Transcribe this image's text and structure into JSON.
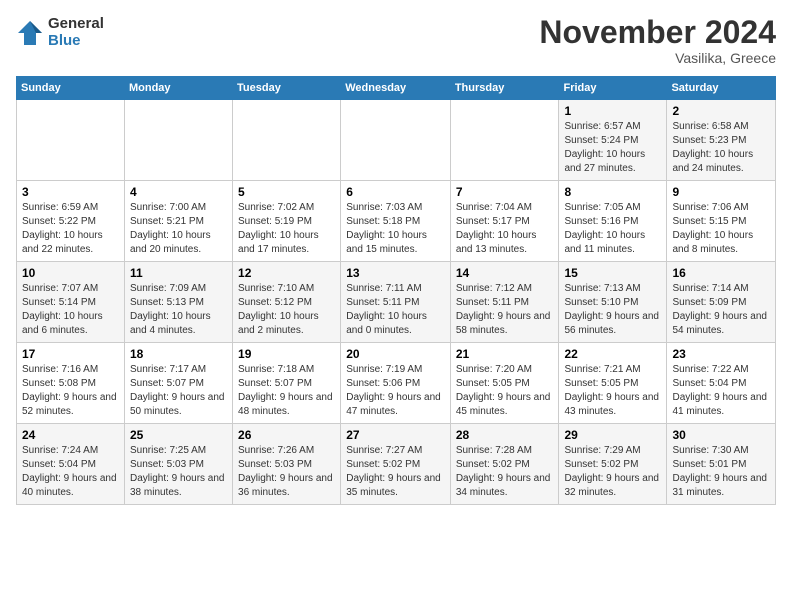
{
  "logo": {
    "general": "General",
    "blue": "Blue"
  },
  "title": "November 2024",
  "location": "Vasilika, Greece",
  "days_header": [
    "Sunday",
    "Monday",
    "Tuesday",
    "Wednesday",
    "Thursday",
    "Friday",
    "Saturday"
  ],
  "weeks": [
    [
      {
        "day": "",
        "info": ""
      },
      {
        "day": "",
        "info": ""
      },
      {
        "day": "",
        "info": ""
      },
      {
        "day": "",
        "info": ""
      },
      {
        "day": "",
        "info": ""
      },
      {
        "day": "1",
        "info": "Sunrise: 6:57 AM\nSunset: 5:24 PM\nDaylight: 10 hours and 27 minutes."
      },
      {
        "day": "2",
        "info": "Sunrise: 6:58 AM\nSunset: 5:23 PM\nDaylight: 10 hours and 24 minutes."
      }
    ],
    [
      {
        "day": "3",
        "info": "Sunrise: 6:59 AM\nSunset: 5:22 PM\nDaylight: 10 hours and 22 minutes."
      },
      {
        "day": "4",
        "info": "Sunrise: 7:00 AM\nSunset: 5:21 PM\nDaylight: 10 hours and 20 minutes."
      },
      {
        "day": "5",
        "info": "Sunrise: 7:02 AM\nSunset: 5:19 PM\nDaylight: 10 hours and 17 minutes."
      },
      {
        "day": "6",
        "info": "Sunrise: 7:03 AM\nSunset: 5:18 PM\nDaylight: 10 hours and 15 minutes."
      },
      {
        "day": "7",
        "info": "Sunrise: 7:04 AM\nSunset: 5:17 PM\nDaylight: 10 hours and 13 minutes."
      },
      {
        "day": "8",
        "info": "Sunrise: 7:05 AM\nSunset: 5:16 PM\nDaylight: 10 hours and 11 minutes."
      },
      {
        "day": "9",
        "info": "Sunrise: 7:06 AM\nSunset: 5:15 PM\nDaylight: 10 hours and 8 minutes."
      }
    ],
    [
      {
        "day": "10",
        "info": "Sunrise: 7:07 AM\nSunset: 5:14 PM\nDaylight: 10 hours and 6 minutes."
      },
      {
        "day": "11",
        "info": "Sunrise: 7:09 AM\nSunset: 5:13 PM\nDaylight: 10 hours and 4 minutes."
      },
      {
        "day": "12",
        "info": "Sunrise: 7:10 AM\nSunset: 5:12 PM\nDaylight: 10 hours and 2 minutes."
      },
      {
        "day": "13",
        "info": "Sunrise: 7:11 AM\nSunset: 5:11 PM\nDaylight: 10 hours and 0 minutes."
      },
      {
        "day": "14",
        "info": "Sunrise: 7:12 AM\nSunset: 5:11 PM\nDaylight: 9 hours and 58 minutes."
      },
      {
        "day": "15",
        "info": "Sunrise: 7:13 AM\nSunset: 5:10 PM\nDaylight: 9 hours and 56 minutes."
      },
      {
        "day": "16",
        "info": "Sunrise: 7:14 AM\nSunset: 5:09 PM\nDaylight: 9 hours and 54 minutes."
      }
    ],
    [
      {
        "day": "17",
        "info": "Sunrise: 7:16 AM\nSunset: 5:08 PM\nDaylight: 9 hours and 52 minutes."
      },
      {
        "day": "18",
        "info": "Sunrise: 7:17 AM\nSunset: 5:07 PM\nDaylight: 9 hours and 50 minutes."
      },
      {
        "day": "19",
        "info": "Sunrise: 7:18 AM\nSunset: 5:07 PM\nDaylight: 9 hours and 48 minutes."
      },
      {
        "day": "20",
        "info": "Sunrise: 7:19 AM\nSunset: 5:06 PM\nDaylight: 9 hours and 47 minutes."
      },
      {
        "day": "21",
        "info": "Sunrise: 7:20 AM\nSunset: 5:05 PM\nDaylight: 9 hours and 45 minutes."
      },
      {
        "day": "22",
        "info": "Sunrise: 7:21 AM\nSunset: 5:05 PM\nDaylight: 9 hours and 43 minutes."
      },
      {
        "day": "23",
        "info": "Sunrise: 7:22 AM\nSunset: 5:04 PM\nDaylight: 9 hours and 41 minutes."
      }
    ],
    [
      {
        "day": "24",
        "info": "Sunrise: 7:24 AM\nSunset: 5:04 PM\nDaylight: 9 hours and 40 minutes."
      },
      {
        "day": "25",
        "info": "Sunrise: 7:25 AM\nSunset: 5:03 PM\nDaylight: 9 hours and 38 minutes."
      },
      {
        "day": "26",
        "info": "Sunrise: 7:26 AM\nSunset: 5:03 PM\nDaylight: 9 hours and 36 minutes."
      },
      {
        "day": "27",
        "info": "Sunrise: 7:27 AM\nSunset: 5:02 PM\nDaylight: 9 hours and 35 minutes."
      },
      {
        "day": "28",
        "info": "Sunrise: 7:28 AM\nSunset: 5:02 PM\nDaylight: 9 hours and 34 minutes."
      },
      {
        "day": "29",
        "info": "Sunrise: 7:29 AM\nSunset: 5:02 PM\nDaylight: 9 hours and 32 minutes."
      },
      {
        "day": "30",
        "info": "Sunrise: 7:30 AM\nSunset: 5:01 PM\nDaylight: 9 hours and 31 minutes."
      }
    ]
  ]
}
